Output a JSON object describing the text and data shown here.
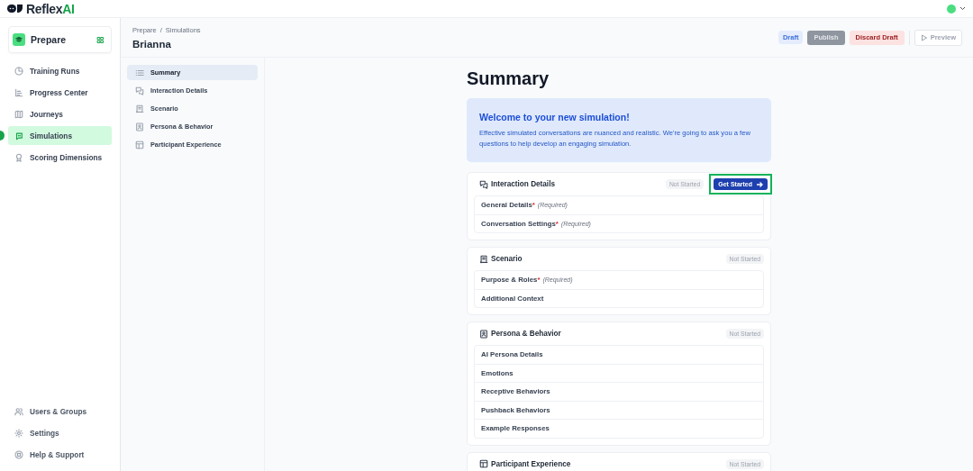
{
  "logo": {
    "name": "Reflex",
    "accent": "AI"
  },
  "workspace": {
    "label": "Prepare"
  },
  "sidebar": {
    "items": [
      {
        "label": "Training Runs",
        "selected": false
      },
      {
        "label": "Progress Center",
        "selected": false
      },
      {
        "label": "Journeys",
        "selected": false
      },
      {
        "label": "Simulations",
        "selected": true
      },
      {
        "label": "Scoring Dimensions",
        "selected": false
      }
    ],
    "footer_items": [
      {
        "label": "Users & Groups"
      },
      {
        "label": "Settings"
      },
      {
        "label": "Help & Support"
      }
    ]
  },
  "header": {
    "breadcrumb": [
      "Prepare",
      "Simulations"
    ],
    "separator": "/",
    "title": "Brianna",
    "status_badge": "Draft",
    "buttons": [
      {
        "label": "Publish",
        "kind": "primary",
        "disabled": true
      },
      {
        "label": "Discard Draft",
        "kind": "danger",
        "disabled": false
      },
      {
        "label": "Preview",
        "kind": "outline",
        "disabled": true
      }
    ]
  },
  "subnav": {
    "items": [
      {
        "label": "Summary",
        "selected": true
      },
      {
        "label": "Interaction Details",
        "selected": false
      },
      {
        "label": "Scenario",
        "selected": false
      },
      {
        "label": "Persona & Behavior",
        "selected": false
      },
      {
        "label": "Participant Experience",
        "selected": false
      }
    ]
  },
  "summary": {
    "title": "Summary",
    "welcome": {
      "title": "Welcome to your new simulation!",
      "text": "Effective simulated conversations are nuanced and realistic. We're going to ask you a few questions to help develop an engaging simulation."
    },
    "sections": [
      {
        "title": "Interaction Details",
        "status": "Not Started",
        "action": {
          "label": "Get Started",
          "highlighted": true
        },
        "items": [
          {
            "label": "General Details",
            "mark": "*",
            "note": "(Required)"
          },
          {
            "label": "Conversation Settings",
            "mark": "*",
            "note": "(Required)"
          }
        ]
      },
      {
        "title": "Scenario",
        "status": "Not Started",
        "items": [
          {
            "label": "Purpose & Roles",
            "mark": "*",
            "note": "(Required)"
          },
          {
            "label": "Additional Context"
          }
        ]
      },
      {
        "title": "Persona & Behavior",
        "status": "Not Started",
        "items": [
          {
            "label": "AI Persona Details"
          },
          {
            "label": "Emotions"
          },
          {
            "label": "Receptive Behaviors"
          },
          {
            "label": "Pushback Behaviors"
          },
          {
            "label": "Example Responses"
          }
        ]
      },
      {
        "title": "Participant Experience",
        "status": "Not Started"
      }
    ]
  }
}
